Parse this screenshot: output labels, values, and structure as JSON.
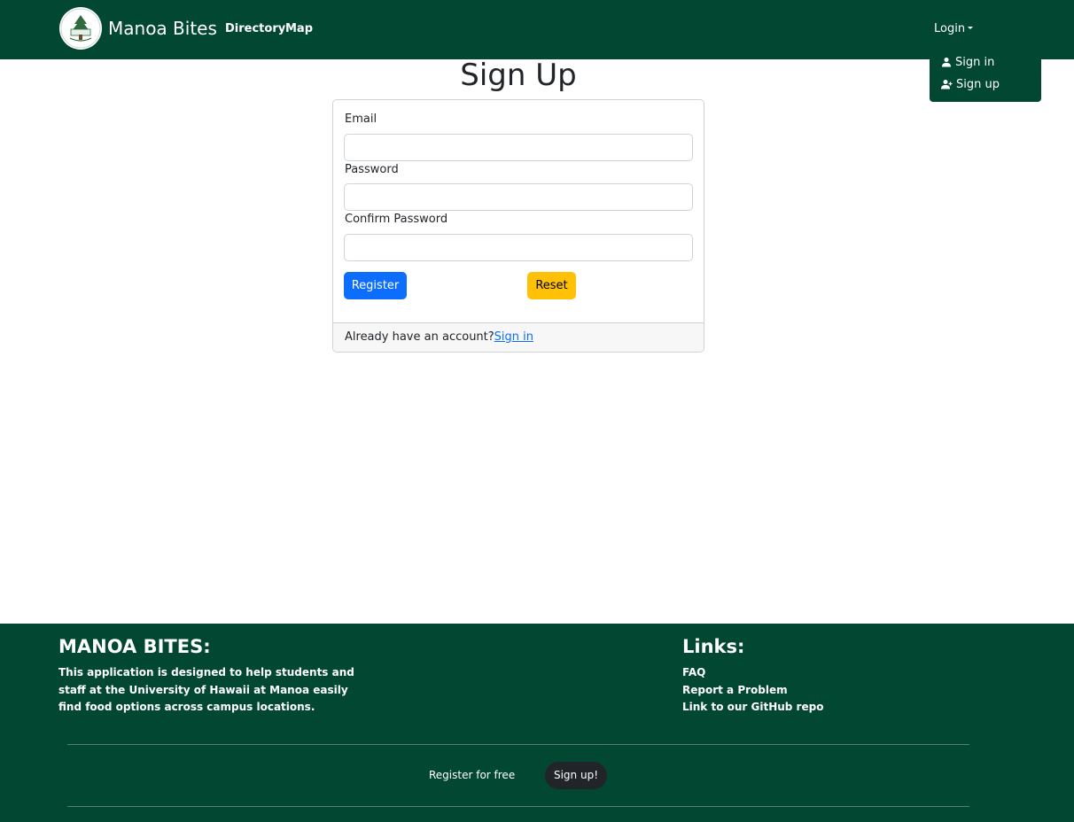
{
  "navbar": {
    "brand_name": "Manoa Bites",
    "logo_text": "MANOA BITES",
    "links": [
      {
        "label": "Directory"
      },
      {
        "label": "Map"
      }
    ],
    "login_label": "Login",
    "dropdown": [
      {
        "label": "Sign in",
        "icon": "person-icon"
      },
      {
        "label": "Sign up",
        "icon": "person-plus-icon"
      }
    ],
    "colors": {
      "background": "#024731",
      "text": "#ffffff"
    }
  },
  "main": {
    "title": "Sign Up",
    "form": {
      "email_label": "Email",
      "email_value": "",
      "password_label": "Password",
      "password_value": "",
      "confirm_label": "Confirm Password",
      "confirm_value": "",
      "register_label": "Register",
      "reset_label": "Reset"
    },
    "card_footer": {
      "text": "Already have an account?",
      "link": "Sign in"
    },
    "colors": {
      "primary": "#0d6efd",
      "warning": "#ffc107"
    }
  },
  "footer": {
    "about_heading": "MANOA BITES:",
    "about_text": "This application is designed to help students and staff at the University of Hawaii at Manoa easily find food options across campus locations.",
    "links_heading": "Links:",
    "links": [
      {
        "label": "FAQ"
      },
      {
        "label": "Report a Problem"
      },
      {
        "label": "Link to our GitHub repo"
      }
    ],
    "register_text": "Register for free",
    "signup_button": "Sign up!"
  }
}
